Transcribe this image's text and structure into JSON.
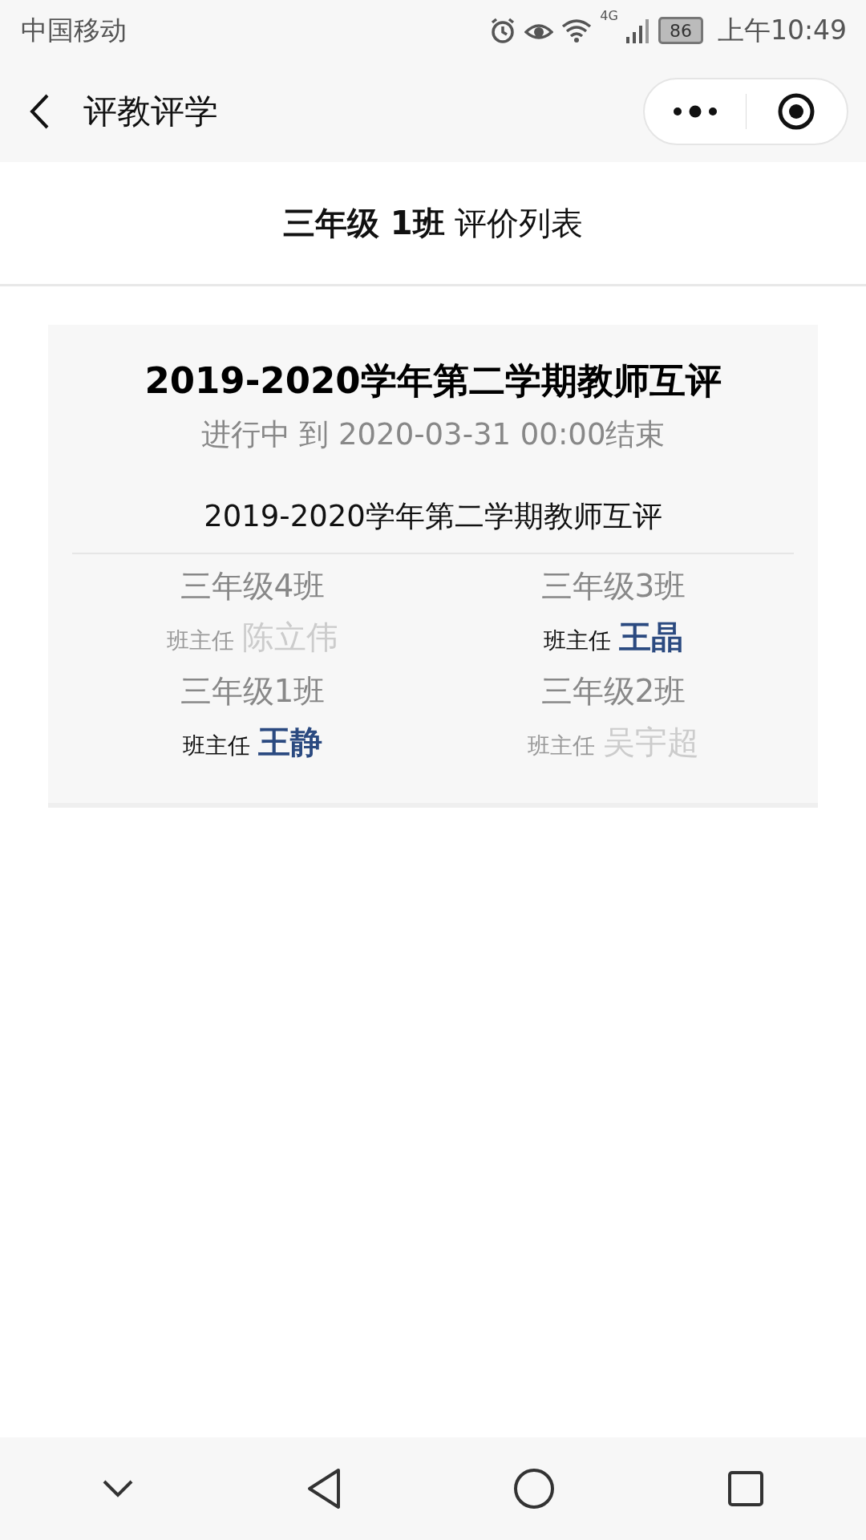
{
  "status_bar": {
    "carrier": "中国移动",
    "network": "4G",
    "battery": "86",
    "time": "上午10:49"
  },
  "nav_bar": {
    "title": "评教评学"
  },
  "page_header": {
    "title": "**三年级 1班** 评价列表"
  },
  "evaluation": {
    "title": "2019-2020学年第二学期教师互评",
    "status": "进行中 到 2020-03-31 00:00结束",
    "subtitle": "2019-2020学年第二学期教师互评",
    "classes": [
      {
        "name": "三年级4班",
        "role": "班主任",
        "teacher": "陈立伟",
        "evaluated": false
      },
      {
        "name": "三年级3班",
        "role": "班主任",
        "teacher": "王晶",
        "evaluated": true
      },
      {
        "name": "三年级1班",
        "role": "班主任",
        "teacher": "王静",
        "evaluated": true
      },
      {
        "name": "三年级2班",
        "role": "班主任",
        "teacher": "吴宇超",
        "evaluated": false
      }
    ]
  }
}
